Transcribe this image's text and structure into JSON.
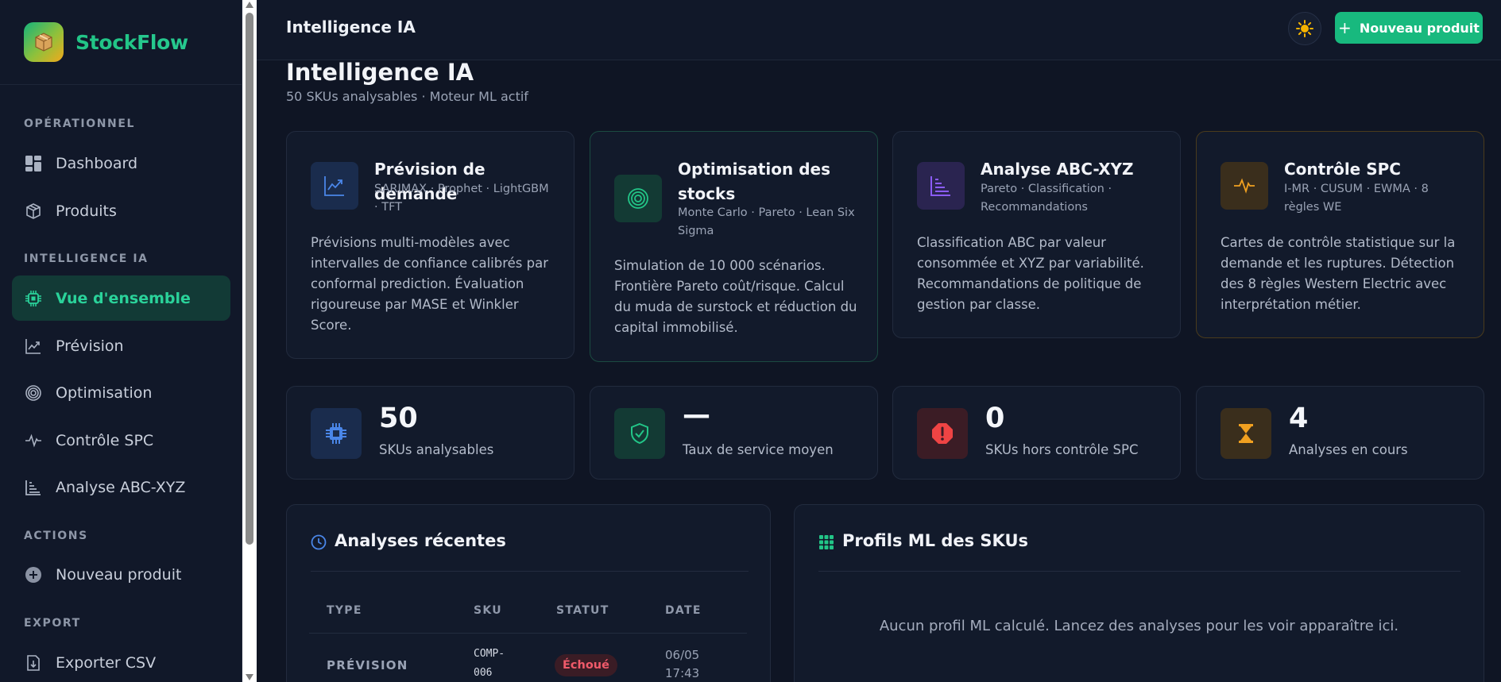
{
  "brand": {
    "name_a": "Stock",
    "name_b": "Flow"
  },
  "sidebar": {
    "sections": [
      "OPÉRATIONNEL",
      "INTELLIGENCE IA",
      "ACTIONS",
      "EXPORT"
    ],
    "items": [
      {
        "label": "Dashboard",
        "icon": "dashboard-icon"
      },
      {
        "label": "Produits",
        "icon": "box-icon"
      },
      {
        "label": "Vue d'ensemble",
        "icon": "chip-icon",
        "active": true
      },
      {
        "label": "Prévision",
        "icon": "trend-icon"
      },
      {
        "label": "Optimisation",
        "icon": "target-icon"
      },
      {
        "label": "Contrôle SPC",
        "icon": "pulse-icon"
      },
      {
        "label": "Analyse ABC-XYZ",
        "icon": "bars-icon"
      },
      {
        "label": "Nouveau produit",
        "icon": "plus-circle-icon"
      },
      {
        "label": "Exporter CSV",
        "icon": "file-download-icon"
      }
    ]
  },
  "topbar": {
    "title": "Intelligence IA",
    "new_button": "Nouveau produit"
  },
  "page": {
    "title": "Intelligence IA",
    "subtitle": "50 SKUs analysables · Moteur ML actif"
  },
  "modules": [
    {
      "title": "Prévision de demande",
      "sub": "SARIMAX · Prophet · LightGBM · TFT",
      "desc": "Prévisions multi-modèles avec intervalles de confiance calibrés par conformal prediction. Évaluation rigoureuse par MASE et Winkler Score."
    },
    {
      "title": "Optimisation des stocks",
      "sub": "Monte Carlo · Pareto · Lean Six Sigma",
      "desc": "Simulation de 10 000 scénarios. Frontière Pareto coût/risque. Calcul du muda de surstock et réduction du capital immobilisé."
    },
    {
      "title": "Analyse ABC-XYZ",
      "sub": "Pareto · Classification · Recommandations",
      "desc": "Classification ABC par valeur consommée et XYZ par variabilité. Recommandations de politique de gestion par classe."
    },
    {
      "title": "Contrôle SPC",
      "sub": "I-MR · CUSUM · EWMA · 8 règles WE",
      "desc": "Cartes de contrôle statistique sur la demande et les ruptures. Détection des 8 règles Western Electric avec interprétation métier."
    }
  ],
  "stats": [
    {
      "value": "50",
      "label": "SKUs analysables"
    },
    {
      "value": "—",
      "label": "Taux de service moyen"
    },
    {
      "value": "0",
      "label": "SKUs hors contrôle SPC"
    },
    {
      "value": "4",
      "label": "Analyses en cours"
    }
  ],
  "recent": {
    "title": "Analyses récentes",
    "columns": [
      "TYPE",
      "SKU",
      "STATUT",
      "DATE"
    ],
    "rows": [
      {
        "type": "PRÉVISION",
        "sku_a": "COMP-",
        "sku_b": "006",
        "status": "Échoué",
        "date_a": "06/05",
        "date_b": "17:43"
      }
    ]
  },
  "profiles": {
    "title": "Profils ML des SKUs",
    "empty": "Aucun profil ML calculé. Lancez des analyses pour les voir apparaître ici."
  },
  "colors": {
    "accent": "#18b97e",
    "blue": "#4a86e8",
    "purple": "#8b5cf6",
    "amber": "#f0a020",
    "danger": "#ef4444"
  }
}
